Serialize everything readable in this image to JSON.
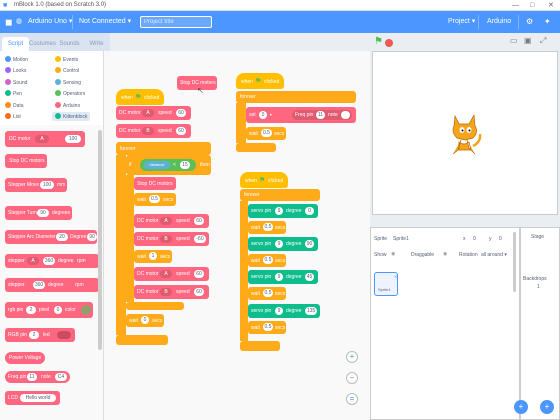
{
  "titlebar": {
    "title": "mBlock 1.0 (based on Scratch 3.0)",
    "min": "—",
    "max": "□",
    "close": "✕"
  },
  "menubar": {
    "device": "Arduino Uno",
    "connection": "Not Connected",
    "title_placeholder": "Project title",
    "project": "Project",
    "board": "Arduino"
  },
  "tabs": [
    "Script",
    "Costumes",
    "Sounds",
    "Write"
  ],
  "categories": [
    {
      "label": "Motion",
      "color": "#4c97ff"
    },
    {
      "label": "Events",
      "color": "#ffbf00"
    },
    {
      "label": "Looks",
      "color": "#9966ff"
    },
    {
      "label": "Control",
      "color": "#ffab19"
    },
    {
      "label": "Sound",
      "color": "#cf63cf"
    },
    {
      "label": "Sensing",
      "color": "#5cb1d6"
    },
    {
      "label": "Pen",
      "color": "#0fbd8c"
    },
    {
      "label": "Operators",
      "color": "#59c059"
    },
    {
      "label": "Data",
      "color": "#ff8c1a"
    },
    {
      "label": "Arduino",
      "color": "#ff6680"
    },
    {
      "label": "List",
      "color": "#ff661a"
    },
    {
      "label": "Kittenblock",
      "color": "#0fbd8c"
    }
  ],
  "palette": {
    "dc_motor": "DC motor",
    "dc_port": "A",
    "dc_speed": "100",
    "stop_dc": "Stop DC motors",
    "stepper_move": "Stepper Move",
    "stepper_move_val": "100",
    "stepper_move_unit": "mm",
    "stepper_turn": "Stepper Turn",
    "stepper_turn_val": "90",
    "stepper_turn_unit": "degrees",
    "stepper_arc": "Stepper Arc Diameter",
    "stepper_arc_val": "20",
    "stepper_arc_deg": "Degree",
    "stepper_arc_deg_val": "90",
    "stepper_a": "stepper",
    "stepper_a_port": "A",
    "stepper_a_val": "360",
    "stepper_a_unit": "degree",
    "stepper_a_rpm": "rpm",
    "stepper_b": "stepper",
    "stepper_b_val": "360",
    "stepper_b_unit": "degree",
    "stepper_b_rpm": "rpm",
    "rgb_pin": "rgb pin",
    "rgb_pin_val": "2",
    "rgb_pixel": "pixel",
    "rgb_pixel_val": "0",
    "rgb_color": "color",
    "rgb_pin2": "RGB pin",
    "rgb_pin2_val": "2",
    "rgb_pin2_led": "led",
    "power_voltage": "Power Voltage",
    "freq": "Freq pin",
    "freq_val": "11",
    "freq_note": "note",
    "freq_note_val": "C4",
    "lcd": "LCD",
    "lcd_val": "Hello world"
  },
  "script1": {
    "stop_dc": "Stop DC motors",
    "hat": "when",
    "hat2": "clicked",
    "m1": "DC motor",
    "m1_port": "A",
    "m1_speed_lbl": "speed",
    "m1_speed": "60",
    "m2": "DC motor",
    "m2_port": "B",
    "m2_speed_lbl": "speed",
    "m2_speed": "60",
    "forever": "forever",
    "if": "if",
    "then": "then",
    "dist_lbl": "distance",
    "lt": "<",
    "dist_val": "15",
    "stop2": "Stop DC motors",
    "wait1": "wait",
    "wait1_val": "0.5",
    "wait1_unit": "secs",
    "m3": "DC motor",
    "m3_port": "A",
    "m3_speed_lbl": "speed",
    "m3_speed": "60",
    "m4": "DC motor",
    "m4_port": "B",
    "m4_speed_lbl": "speed",
    "m4_speed": "-60",
    "wait2": "wait",
    "wait2_val": "1",
    "wait2_unit": "secs",
    "m5": "DC motor",
    "m5_port": "A",
    "m5_speed_lbl": "speed",
    "m5_speed": "60",
    "m6": "DC motor",
    "m6_port": "B",
    "m6_speed_lbl": "speed",
    "m6_speed": "60",
    "wait3": "wait",
    "wait3_val": "0",
    "wait3_unit": "secs"
  },
  "script2": {
    "hat": "when",
    "hat2": "clicked",
    "forever": "forever",
    "set": "set",
    "set_val": "0",
    "freq_lbl": "Freq pin",
    "freq_val": "11",
    "note_lbl": "note",
    "wait": "wait",
    "wait_val": "0.5",
    "wait_unit": "secs"
  },
  "script3": {
    "hat": "when",
    "hat2": "clicked",
    "forever": "forever",
    "servo": "servo pin",
    "degree": "degree",
    "rows": [
      {
        "pin": "9",
        "deg": "0",
        "wait": "0.5"
      },
      {
        "pin": "9",
        "deg": "90",
        "wait": "0.5"
      },
      {
        "pin": "9",
        "deg": "45",
        "wait": "0.5"
      },
      {
        "pin": "9",
        "deg": "135",
        "wait": "0.5"
      }
    ],
    "wait_lbl": "wait",
    "secs": "secs"
  },
  "sprite": {
    "label": "Sprite",
    "name": "Sprite1",
    "x_lbl": "x",
    "x_val": "0",
    "y_lbl": "y",
    "y_val": "0",
    "show": "Show",
    "draggable": "Draggable",
    "rotation": "Rotation",
    "rotation_val": "all around",
    "thumb": "Sprite1"
  },
  "stage": {
    "label": "Stage",
    "backdrops_lbl": "Backdrops",
    "backdrops_val": "1"
  }
}
